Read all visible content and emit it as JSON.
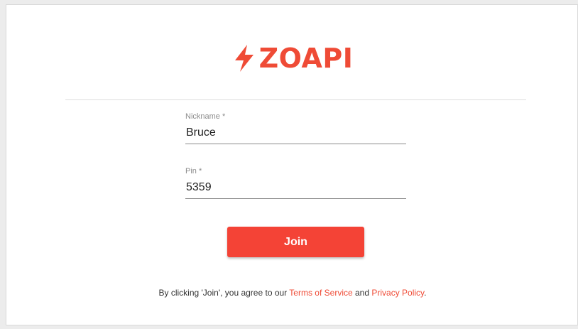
{
  "brand": {
    "name": "ZOAPI",
    "icon": "lightning-bolt-icon",
    "color": "#ef4b36"
  },
  "form": {
    "nickname": {
      "label": "Nickname *",
      "value": "Bruce"
    },
    "pin": {
      "label": "Pin *",
      "value": "5359"
    },
    "join_label": "Join",
    "button_color": "#f44336"
  },
  "legal": {
    "prefix": "By clicking 'Join', you agree to our ",
    "terms_label": "Terms of Service",
    "conjunction": " and ",
    "privacy_label": "Privacy Policy",
    "suffix": "."
  }
}
